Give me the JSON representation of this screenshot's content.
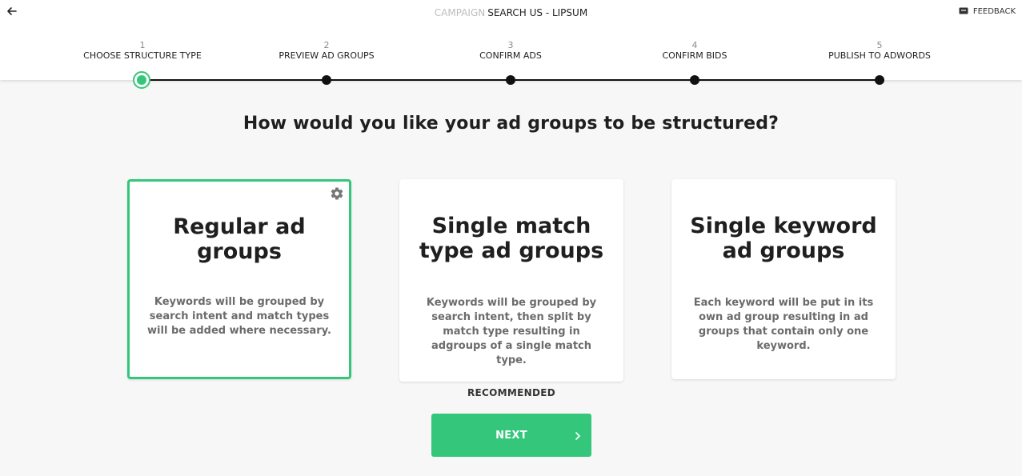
{
  "header": {
    "title_prefix": "CAMPAIGN",
    "title": "SEARCH US - LIPSUM",
    "feedback_label": "FEEDBACK"
  },
  "steps": [
    {
      "number": "1",
      "label": "CHOOSE STRUCTURE TYPE"
    },
    {
      "number": "2",
      "label": "PREVIEW AD GROUPS"
    },
    {
      "number": "3",
      "label": "CONFIRM ADS"
    },
    {
      "number": "4",
      "label": "CONFIRM BIDS"
    },
    {
      "number": "5",
      "label": "PUBLISH TO ADWORDS"
    }
  ],
  "current_step": 1,
  "question": "How would you like your ad groups to be structured?",
  "options": [
    {
      "title": "Regular ad groups",
      "description": "Keywords will be grouped by search intent and match types will be added where necessary."
    },
    {
      "title": "Single match type ad groups",
      "description": "Keywords will be grouped by search intent, then split by match type resulting in adgroups of a single match type."
    },
    {
      "title": "Single keyword ad groups",
      "description": "Each keyword will be put in its own ad group resulting in ad groups that contain only one keyword."
    }
  ],
  "selected_option": 0,
  "recommended_label": "RECOMMENDED",
  "next_label": "NEXT",
  "colors": {
    "accent": "#34c77b",
    "text": "#1f1f1f",
    "muted": "#6b6b6b",
    "background": "#f7f7f7"
  },
  "icons": {
    "back": "arrow-left-icon",
    "feedback": "chat-bubble-icon",
    "settings": "gear-icon",
    "next": "chevron-right-icon"
  }
}
